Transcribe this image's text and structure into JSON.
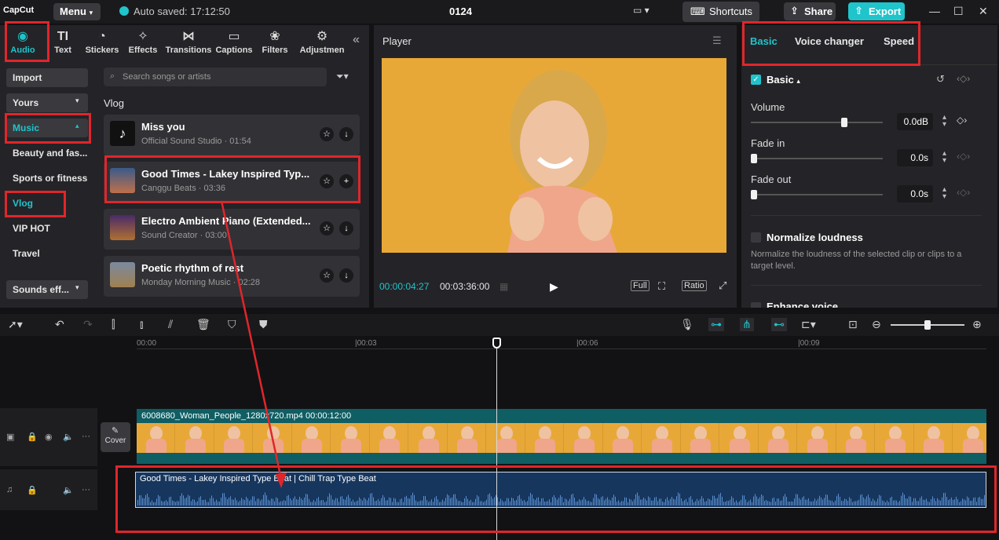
{
  "topbar": {
    "logo": "CapCut",
    "menu_label": "Menu",
    "autosave_text": "Auto saved: 17:12:50",
    "project_name": "0124",
    "shortcuts_label": "Shortcuts",
    "share_label": "Share",
    "export_label": "Export"
  },
  "tools": [
    {
      "label": "Audio",
      "icon": "audio-icon"
    },
    {
      "label": "Text",
      "icon": "text-icon"
    },
    {
      "label": "Stickers",
      "icon": "stickers-icon"
    },
    {
      "label": "Effects",
      "icon": "effects-icon"
    },
    {
      "label": "Transitions",
      "icon": "transitions-icon"
    },
    {
      "label": "Captions",
      "icon": "captions-icon"
    },
    {
      "label": "Filters",
      "icon": "filters-icon"
    },
    {
      "label": "Adjustmen",
      "icon": "adjustment-icon"
    }
  ],
  "categories": {
    "import": "Import",
    "yours": "Yours",
    "music": "Music",
    "beauty": "Beauty and fas...",
    "sports": "Sports or fitness",
    "vlog": "Vlog",
    "vip": "VIP HOT",
    "travel": "Travel",
    "sounds": "Sounds eff..."
  },
  "library": {
    "search_placeholder": "Search songs or artists",
    "section_title": "Vlog",
    "songs": [
      {
        "title": "Miss you",
        "meta": "Official Sound Studio · 01:54"
      },
      {
        "title": "Good Times - Lakey Inspired Typ...",
        "meta": "Canggu Beats · 03:36"
      },
      {
        "title": "Electro Ambient Piano (Extended...",
        "meta": "Sound Creator · 03:00"
      },
      {
        "title": "Poetic rhythm of rest",
        "meta": "Monday Morning Music · 02:28"
      }
    ]
  },
  "player": {
    "title": "Player",
    "current_time": "00:00:04:27",
    "total_time": "00:03:36:00",
    "full_label": "Full",
    "ratio_label": "Ratio"
  },
  "props": {
    "tabs": [
      "Basic",
      "Voice changer",
      "Speed"
    ],
    "section": "Basic",
    "volume_label": "Volume",
    "volume_value": "0.0dB",
    "volume_level": 0.72,
    "fadein_label": "Fade in",
    "fadein_value": "0.0s",
    "fadeout_label": "Fade out",
    "fadeout_value": "0.0s",
    "normalize_label": "Normalize loudness",
    "normalize_desc": "Normalize the loudness of the selected clip or clips to a target level.",
    "enhance_label": "Enhance voice"
  },
  "timeline": {
    "ticks": [
      "00:00",
      "|00:03",
      "|00:06",
      "|00:09"
    ],
    "video_clip_label": "6008680_Woman_People_1280x720.mp4   00:00:12:00",
    "cover_label": "Cover",
    "audio_clip_label": "Good Times - Lakey Inspired Type Beat | Chill Trap Type Beat"
  },
  "colors": {
    "accent": "#20c4cb",
    "highlight": "#e0262b",
    "video_bg": "#e8a838"
  }
}
